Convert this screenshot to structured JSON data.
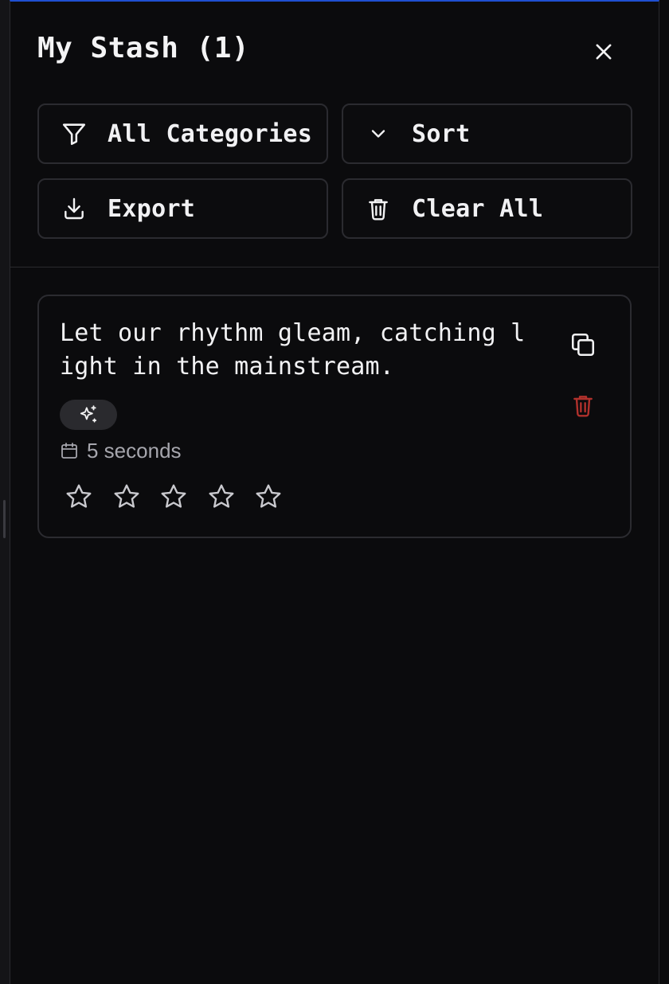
{
  "stash": {
    "title": "My Stash (1)"
  },
  "toolbar": {
    "category_label": "All Categories",
    "sort_label": "Sort",
    "export_label": "Export",
    "clear_label": "Clear All"
  },
  "items": [
    {
      "text": "Let our rhythm gleam, catching light in the mainstream.",
      "tag_icon": "sparkles-icon",
      "time": "5 seconds",
      "rating": 0,
      "max_rating": 5
    }
  ],
  "colors": {
    "accent_top": "#1f4fd1",
    "delete": "#b1312c",
    "muted": "#a6a6ad"
  }
}
